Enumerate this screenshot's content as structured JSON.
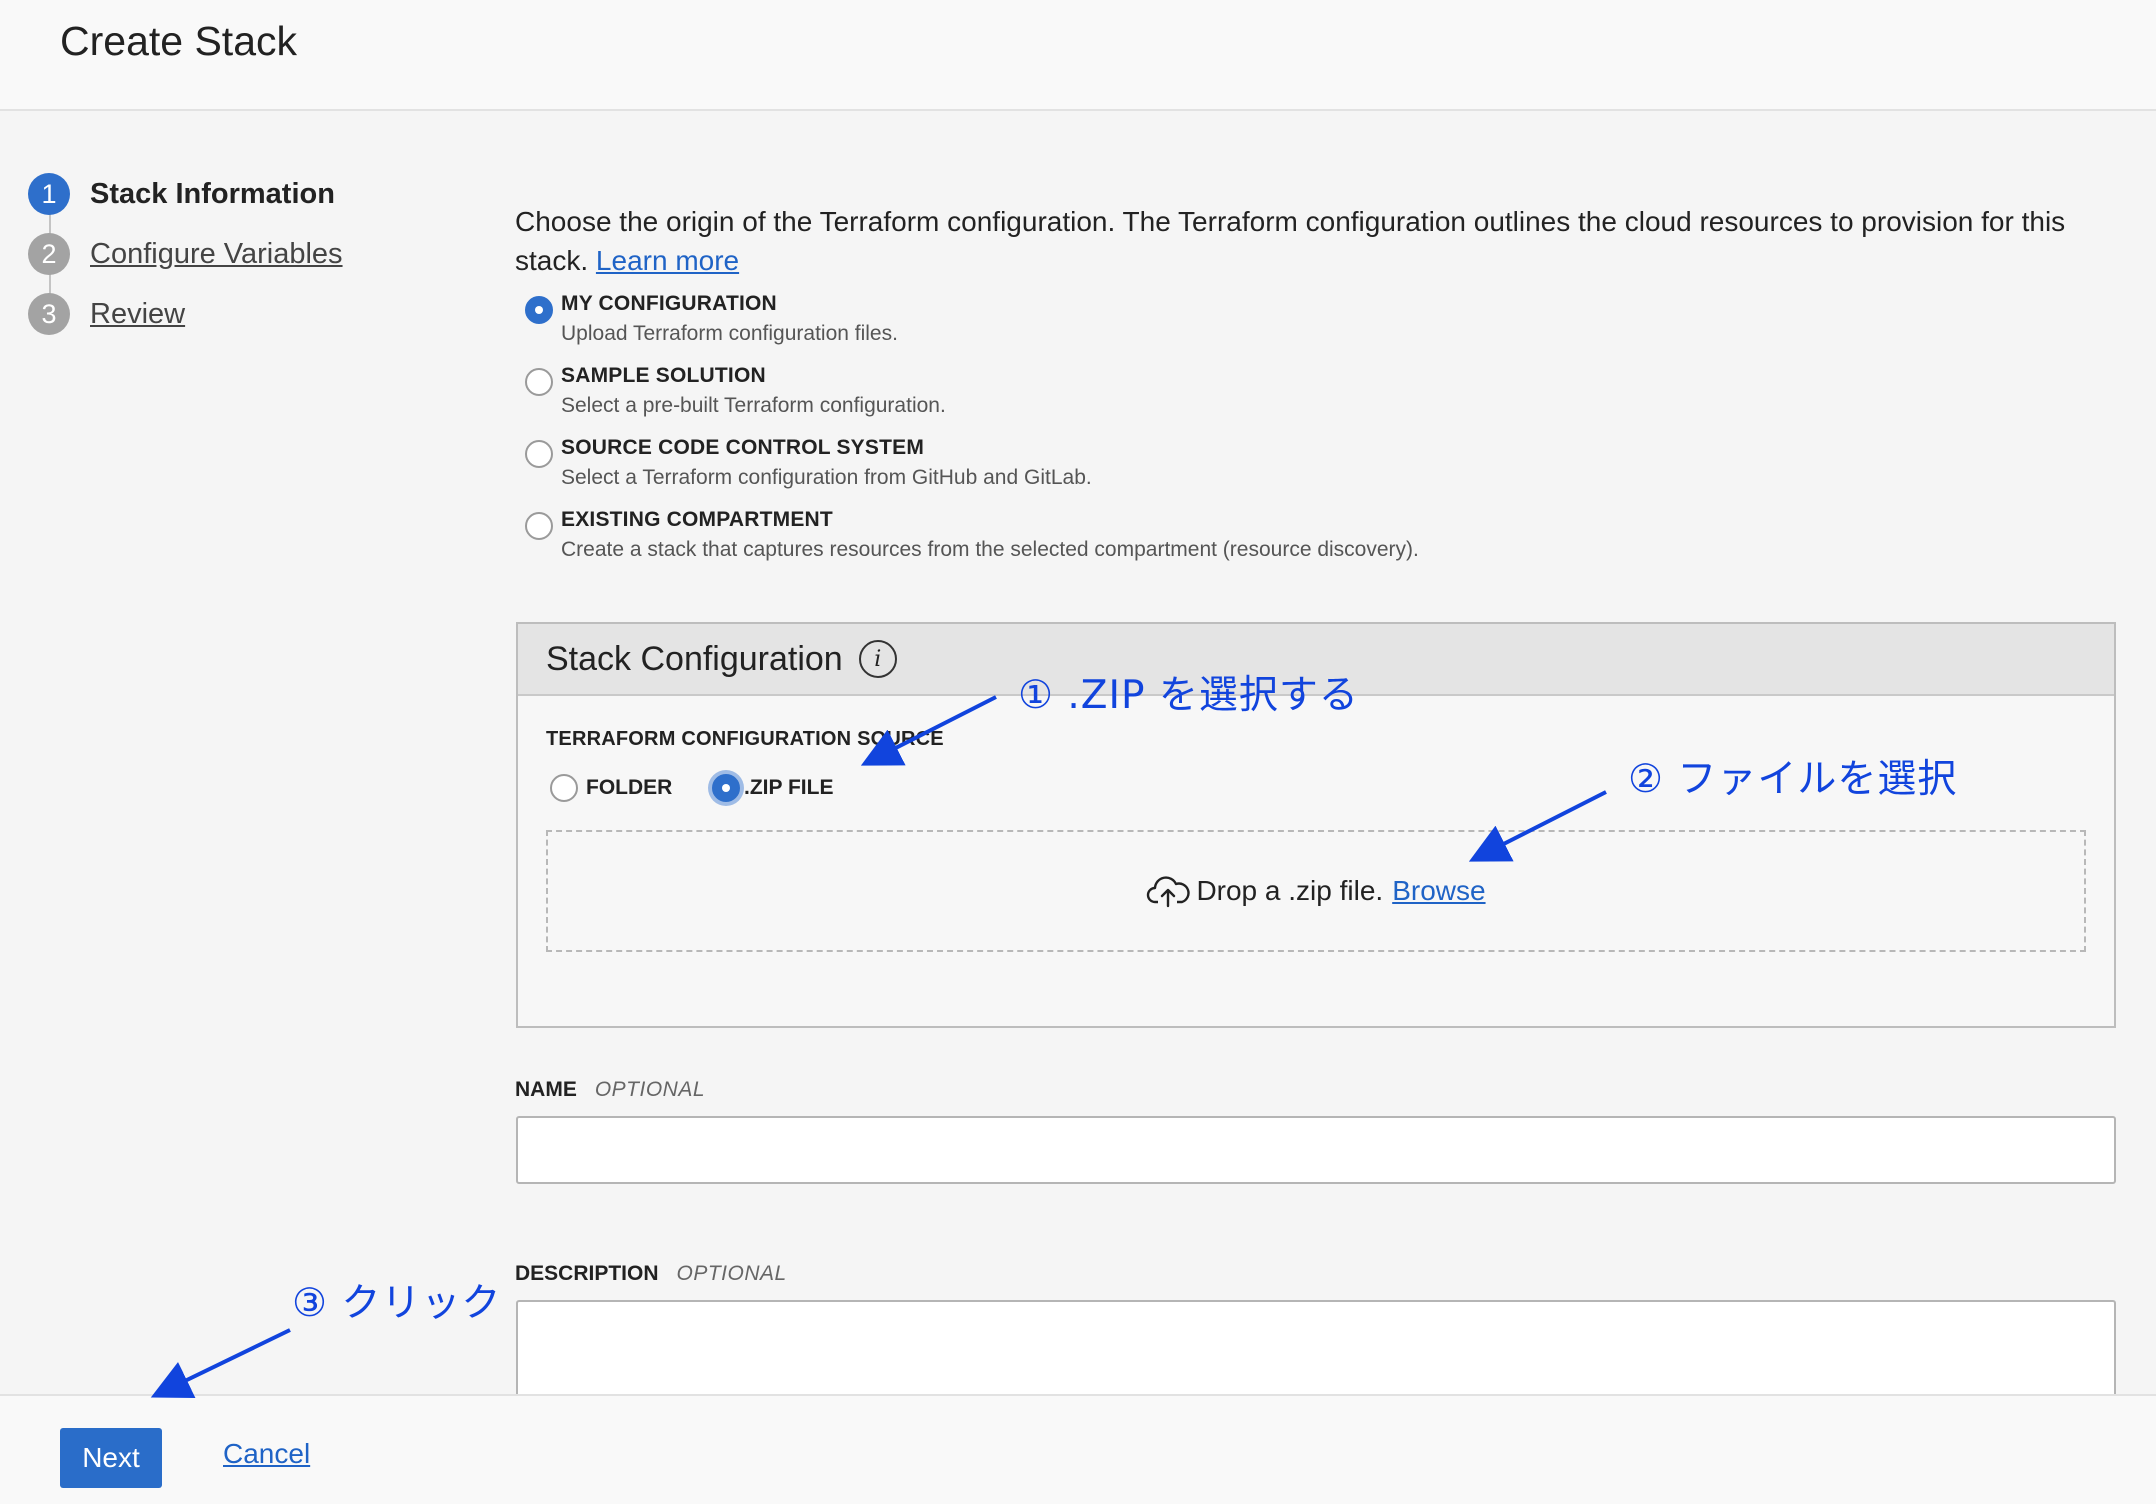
{
  "header": {
    "title": "Create Stack"
  },
  "steps": [
    {
      "num": "1",
      "label": "Stack Information"
    },
    {
      "num": "2",
      "label": "Configure Variables"
    },
    {
      "num": "3",
      "label": "Review"
    }
  ],
  "intro": {
    "text": "Choose the origin of the Terraform configuration. The Terraform configuration outlines the cloud resources to provision for this stack.",
    "link": "Learn more"
  },
  "origin_options": [
    {
      "title": "MY CONFIGURATION",
      "desc": "Upload Terraform configuration files.",
      "selected": true
    },
    {
      "title": "SAMPLE SOLUTION",
      "desc": "Select a pre-built Terraform configuration.",
      "selected": false
    },
    {
      "title": "SOURCE CODE CONTROL SYSTEM",
      "desc": "Select a Terraform configuration from GitHub and GitLab.",
      "selected": false
    },
    {
      "title": "EXISTING COMPARTMENT",
      "desc": "Create a stack that captures resources from the selected compartment (resource discovery).",
      "selected": false
    }
  ],
  "stack_config": {
    "title": "Stack Configuration",
    "info_icon": "info-icon",
    "source_label": "TERRAFORM CONFIGURATION SOURCE",
    "source_options": [
      {
        "label": "FOLDER",
        "selected": false
      },
      {
        "label": ".ZIP FILE",
        "selected": true
      }
    ],
    "drop_text": "Drop a .zip file.",
    "browse_link": "Browse",
    "drop_icon": "cloud-upload-icon"
  },
  "fields": {
    "name_label": "NAME",
    "name_optional": "OPTIONAL",
    "name_value": "",
    "description_label": "DESCRIPTION",
    "description_optional": "OPTIONAL",
    "description_value": ""
  },
  "footer": {
    "next_label": "Next",
    "cancel_label": "Cancel"
  },
  "annotations": {
    "a1": "① .ZIP  を選択する",
    "a2": "② ファイルを選択",
    "a3": "③ クリック",
    "color": "#1144dd"
  },
  "colors": {
    "accent": "#2e6fcb",
    "link": "#1f63c6"
  }
}
